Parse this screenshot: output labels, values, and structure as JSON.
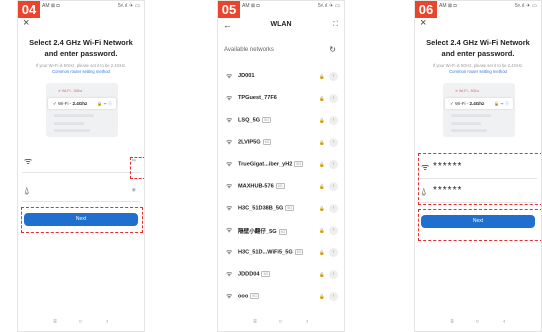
{
  "status": {
    "time": "AM",
    "icons_left": "⊠ ◘",
    "icons_right": "5ᵍ.ıl ✈ ▭"
  },
  "panel1": {
    "step": "04",
    "title_line1": "Select 2.4 GHz Wi-Fi Network",
    "title_line2": "and enter password.",
    "hint": "If your Wi-Fi is 5GHz, please set it to be 2.4GHz.",
    "hint_link": "Common router setting method",
    "mini_row1": "✕ Wi-Fi - 5Ghz",
    "mini_row2_prefix": "✓ Wi-Fi - ",
    "mini_row2_bold": "2.4Ghz",
    "mini_row2_icons": "🔒 ᯤ ⓘ",
    "wifi_aux": "⇆",
    "password_aux": "◉",
    "next_label": "Next"
  },
  "panel2": {
    "step": "05",
    "title": "WLAN",
    "available": "Available networks",
    "networks": [
      {
        "name": "JD001",
        "tag": ""
      },
      {
        "name": "TPGuest_77F6",
        "tag": ""
      },
      {
        "name": "LSQ_5G",
        "tag": "5G"
      },
      {
        "name": "2LVIP5G",
        "tag": "5G"
      },
      {
        "name": "TrueGigat...iber_yH2",
        "tag": "5G"
      },
      {
        "name": "MAXHUB-576",
        "tag": "5G"
      },
      {
        "name": "H3C_51D38B_5G",
        "tag": "5G"
      },
      {
        "name": "隔壁小翻仔_5G",
        "tag": "5G"
      },
      {
        "name": "H3C_51D...WiFi5_5G",
        "tag": "5G"
      },
      {
        "name": "JDDD04",
        "tag": "5G"
      },
      {
        "name": "ooo",
        "tag": "5G"
      }
    ]
  },
  "panel3": {
    "step": "06",
    "title_line1": "Select 2.4 GHz Wi-Fi Network",
    "title_line2": "and enter password.",
    "hint": "If your Wi-Fi is 5GHz, please set it to be 2.4GHz.",
    "hint_link": "Common router setting method",
    "mini_row1": "✕ Wi-Fi - 5Ghz",
    "mini_row2_prefix": "✓ Wi-Fi - ",
    "mini_row2_bold": "2.4Ghz",
    "mini_row2_icons": "🔒 ᯤ ⓘ",
    "wifi_value": "******",
    "password_value": "******",
    "next_label": "Next"
  },
  "nav": {
    "menu": "≡",
    "home": "○",
    "back": "‹"
  },
  "colors": {
    "accent": "#1f6fcf",
    "badge": "#e8452c",
    "highlight": "#e23030"
  }
}
